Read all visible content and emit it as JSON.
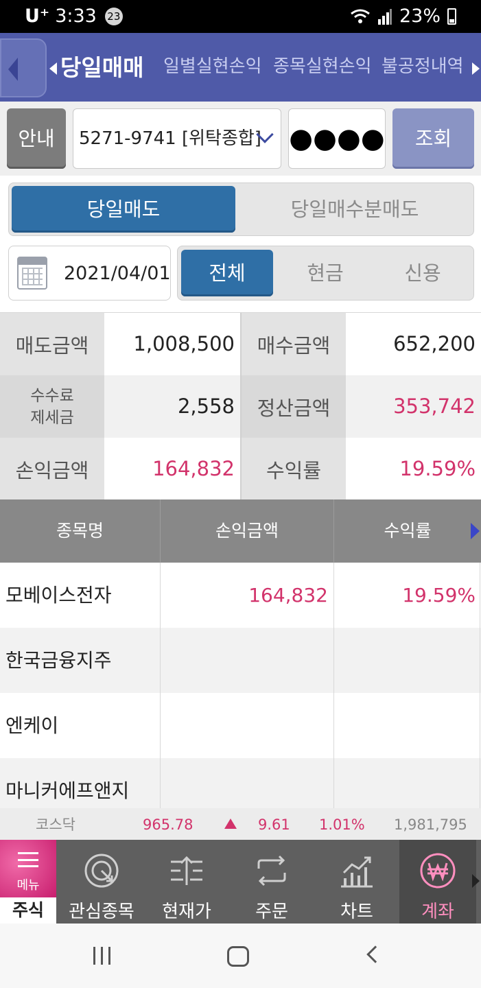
{
  "status_bar": {
    "carrier": "U⁺",
    "time": "3:33",
    "notification_count": "23",
    "battery": "23%"
  },
  "nav": {
    "tabs": [
      {
        "label": "당일매매",
        "active": true
      },
      {
        "label": "일별실현손익",
        "active": false
      },
      {
        "label": "종목실현손익",
        "active": false
      },
      {
        "label": "불공정내역",
        "active": false
      }
    ]
  },
  "account": {
    "guide_label": "안내",
    "account_value": "5271-9741 [위탁종합]",
    "password_mask": "●●●●",
    "query_label": "조회"
  },
  "subtabs": {
    "sell_today": "당일매도",
    "buy_sell_today": "당일매수분매도"
  },
  "filters": {
    "date": "2021/04/01",
    "all": "전체",
    "cash": "현금",
    "credit": "신용"
  },
  "summary": {
    "sell_amount_label": "매도금액",
    "sell_amount": "1,008,500",
    "buy_amount_label": "매수금액",
    "buy_amount": "652,200",
    "fee_label_1": "수수료",
    "fee_label_2": "제세금",
    "fee_amount": "2,558",
    "settle_label": "정산금액",
    "settle_amount": "353,742",
    "pl_label": "손익금액",
    "pl_amount": "164,832",
    "rate_label": "수익률",
    "rate": "19.59%"
  },
  "table": {
    "headers": [
      "종목명",
      "손익금액",
      "수익률"
    ],
    "rows": [
      {
        "name": "모베이스전자",
        "pl": "164,832",
        "rate": "19.59%"
      },
      {
        "name": "한국금융지주",
        "pl": "",
        "rate": ""
      },
      {
        "name": "엔케이",
        "pl": "",
        "rate": ""
      },
      {
        "name": "마니커에프앤지",
        "pl": "",
        "rate": ""
      }
    ]
  },
  "ticker": {
    "name": "코스닥",
    "price": "965.78",
    "change": "9.61",
    "pct": "1.01%",
    "volume": "1,981,795"
  },
  "toolbar": {
    "menu_label": "메뉴",
    "stock_label": "주식",
    "items": [
      {
        "label": "관심종목",
        "icon": "target-icon"
      },
      {
        "label": "현재가",
        "icon": "price-icon"
      },
      {
        "label": "주문",
        "icon": "exchange-icon"
      },
      {
        "label": "차트",
        "icon": "chart-icon"
      },
      {
        "label": "계좌",
        "icon": "won-icon",
        "active": true
      }
    ]
  },
  "colors": {
    "nav_bg": "#4f5aa8",
    "accent_blue": "#2f6fa6",
    "positive": "#d2336b",
    "active_tool": "#ff8fbf"
  }
}
